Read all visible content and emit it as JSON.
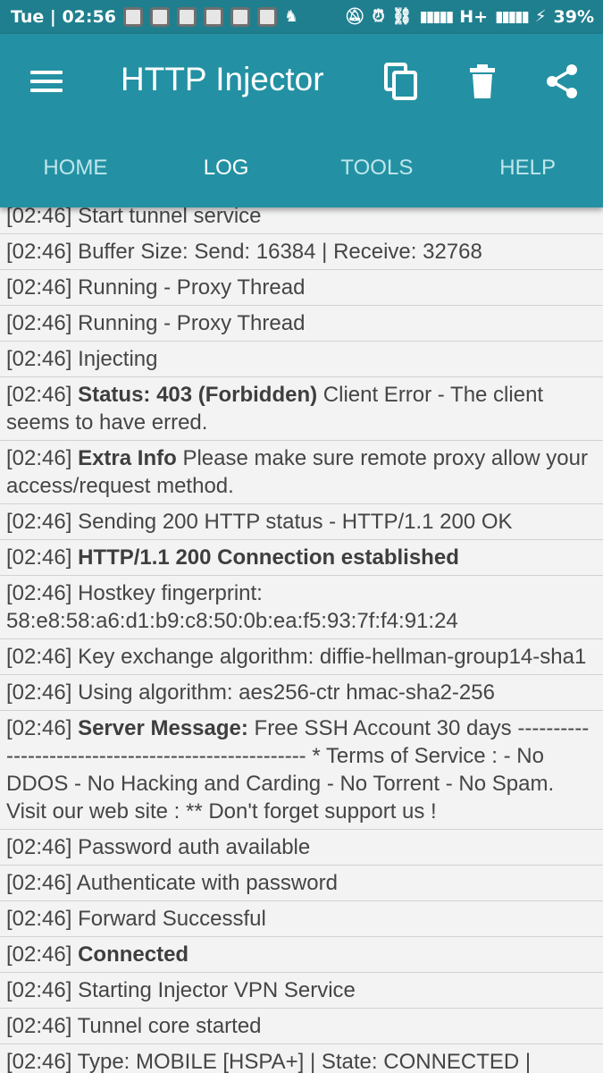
{
  "status_bar": {
    "time": "Tue | 02:56",
    "network": "H+",
    "battery": "39%"
  },
  "app_bar": {
    "title": "HTTP Injector",
    "icons": [
      "menu-icon",
      "copy-icon",
      "trash-icon",
      "share-icon"
    ]
  },
  "tabs": [
    {
      "label": "HOME",
      "active": false
    },
    {
      "label": "LOG",
      "active": true
    },
    {
      "label": "TOOLS",
      "active": false
    },
    {
      "label": "HELP",
      "active": false
    }
  ],
  "log": [
    {
      "time": "[02:46]",
      "bold": "",
      "text": "Start tunnel service"
    },
    {
      "time": "[02:46]",
      "bold": "",
      "text": "Buffer Size: Send: 16384 | Receive: 32768"
    },
    {
      "time": "[02:46]",
      "bold": "",
      "text": "Running - Proxy Thread"
    },
    {
      "time": "[02:46]",
      "bold": "",
      "text": "Running - Proxy Thread"
    },
    {
      "time": "[02:46]",
      "bold": "",
      "text": "Injecting"
    },
    {
      "time": "[02:46]",
      "bold": "Status: 403 (Forbidden)",
      "text": "Client Error - The client seems to have erred."
    },
    {
      "time": "[02:46]",
      "bold": "Extra Info",
      "text": "Please make sure remote proxy allow your access/request method."
    },
    {
      "time": "[02:46]",
      "bold": "",
      "text": "Sending 200 HTTP status - HTTP/1.1 200 OK"
    },
    {
      "time": "[02:46]",
      "bold": "HTTP/1.1 200 Connection established",
      "text": ""
    },
    {
      "time": "[02:46]",
      "bold": "",
      "text": "Hostkey fingerprint: 58:e8:58:a6:d1:b9:c8:50:0b:ea:f5:93:7f:f4:91:24"
    },
    {
      "time": "[02:46]",
      "bold": "",
      "text": "Key exchange algorithm: diffie-hellman-group14-sha1"
    },
    {
      "time": "[02:46]",
      "bold": "",
      "text": "Using algorithm: aes256-ctr hmac-sha2-256"
    },
    {
      "time": "[02:46]",
      "bold": "Server Message:",
      "text": "Free SSH Account 30 days ---------------------------------------------------- * Terms of Service : - No DDOS - No Hacking and Carding - No Torrent - No Spam. Visit our web site : ** Don't forget support us !"
    },
    {
      "time": "[02:46]",
      "bold": "",
      "text": "Password auth available"
    },
    {
      "time": "[02:46]",
      "bold": "",
      "text": "Authenticate with password"
    },
    {
      "time": "[02:46]",
      "bold": "",
      "text": "Forward Successful"
    },
    {
      "time": "[02:46]",
      "bold": "Connected",
      "text": ""
    },
    {
      "time": "[02:46]",
      "bold": "",
      "text": "Starting Injector VPN Service"
    },
    {
      "time": "[02:46]",
      "bold": "",
      "text": "Tunnel core started"
    },
    {
      "time": "[02:46]",
      "bold": "",
      "text": "Type: MOBILE [HSPA+] | State: CONNECTED | Reason: connected | http.globe.com.ph"
    }
  ]
}
